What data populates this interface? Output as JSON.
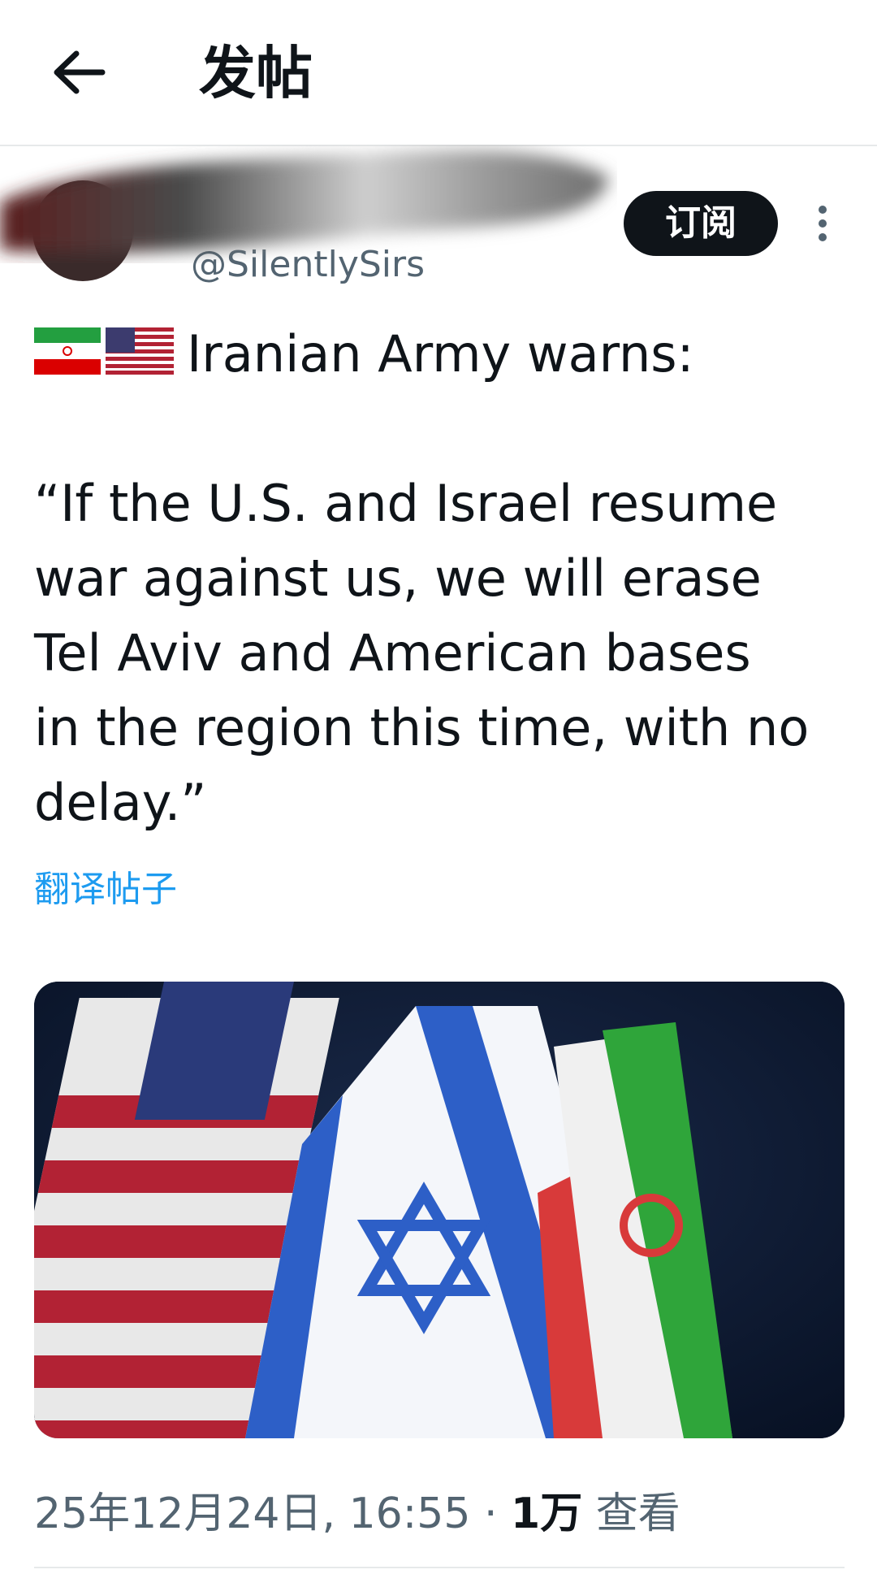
{
  "header": {
    "title": "发帖"
  },
  "author": {
    "handle": "@SilentlySirs",
    "subscribe_label": "订阅"
  },
  "post": {
    "headline": "Iranian Army warns:",
    "body": "“If the U.S. and Israel resume\nwar against us, we will erase\nTel Aviv and American bases\nin the region this time, with no\ndelay.”",
    "translate_label": "翻译帖子"
  },
  "meta": {
    "date": "25年12月24日, 16:55",
    "views_count": "1万",
    "views_label": "查看"
  },
  "colors": {
    "link": "#1d9bf0",
    "text": "#0f1419",
    "muted": "#536471"
  },
  "icons": [
    "back-arrow-icon",
    "more-vertical-icon",
    "iran-flag-emoji",
    "us-flag-emoji"
  ]
}
